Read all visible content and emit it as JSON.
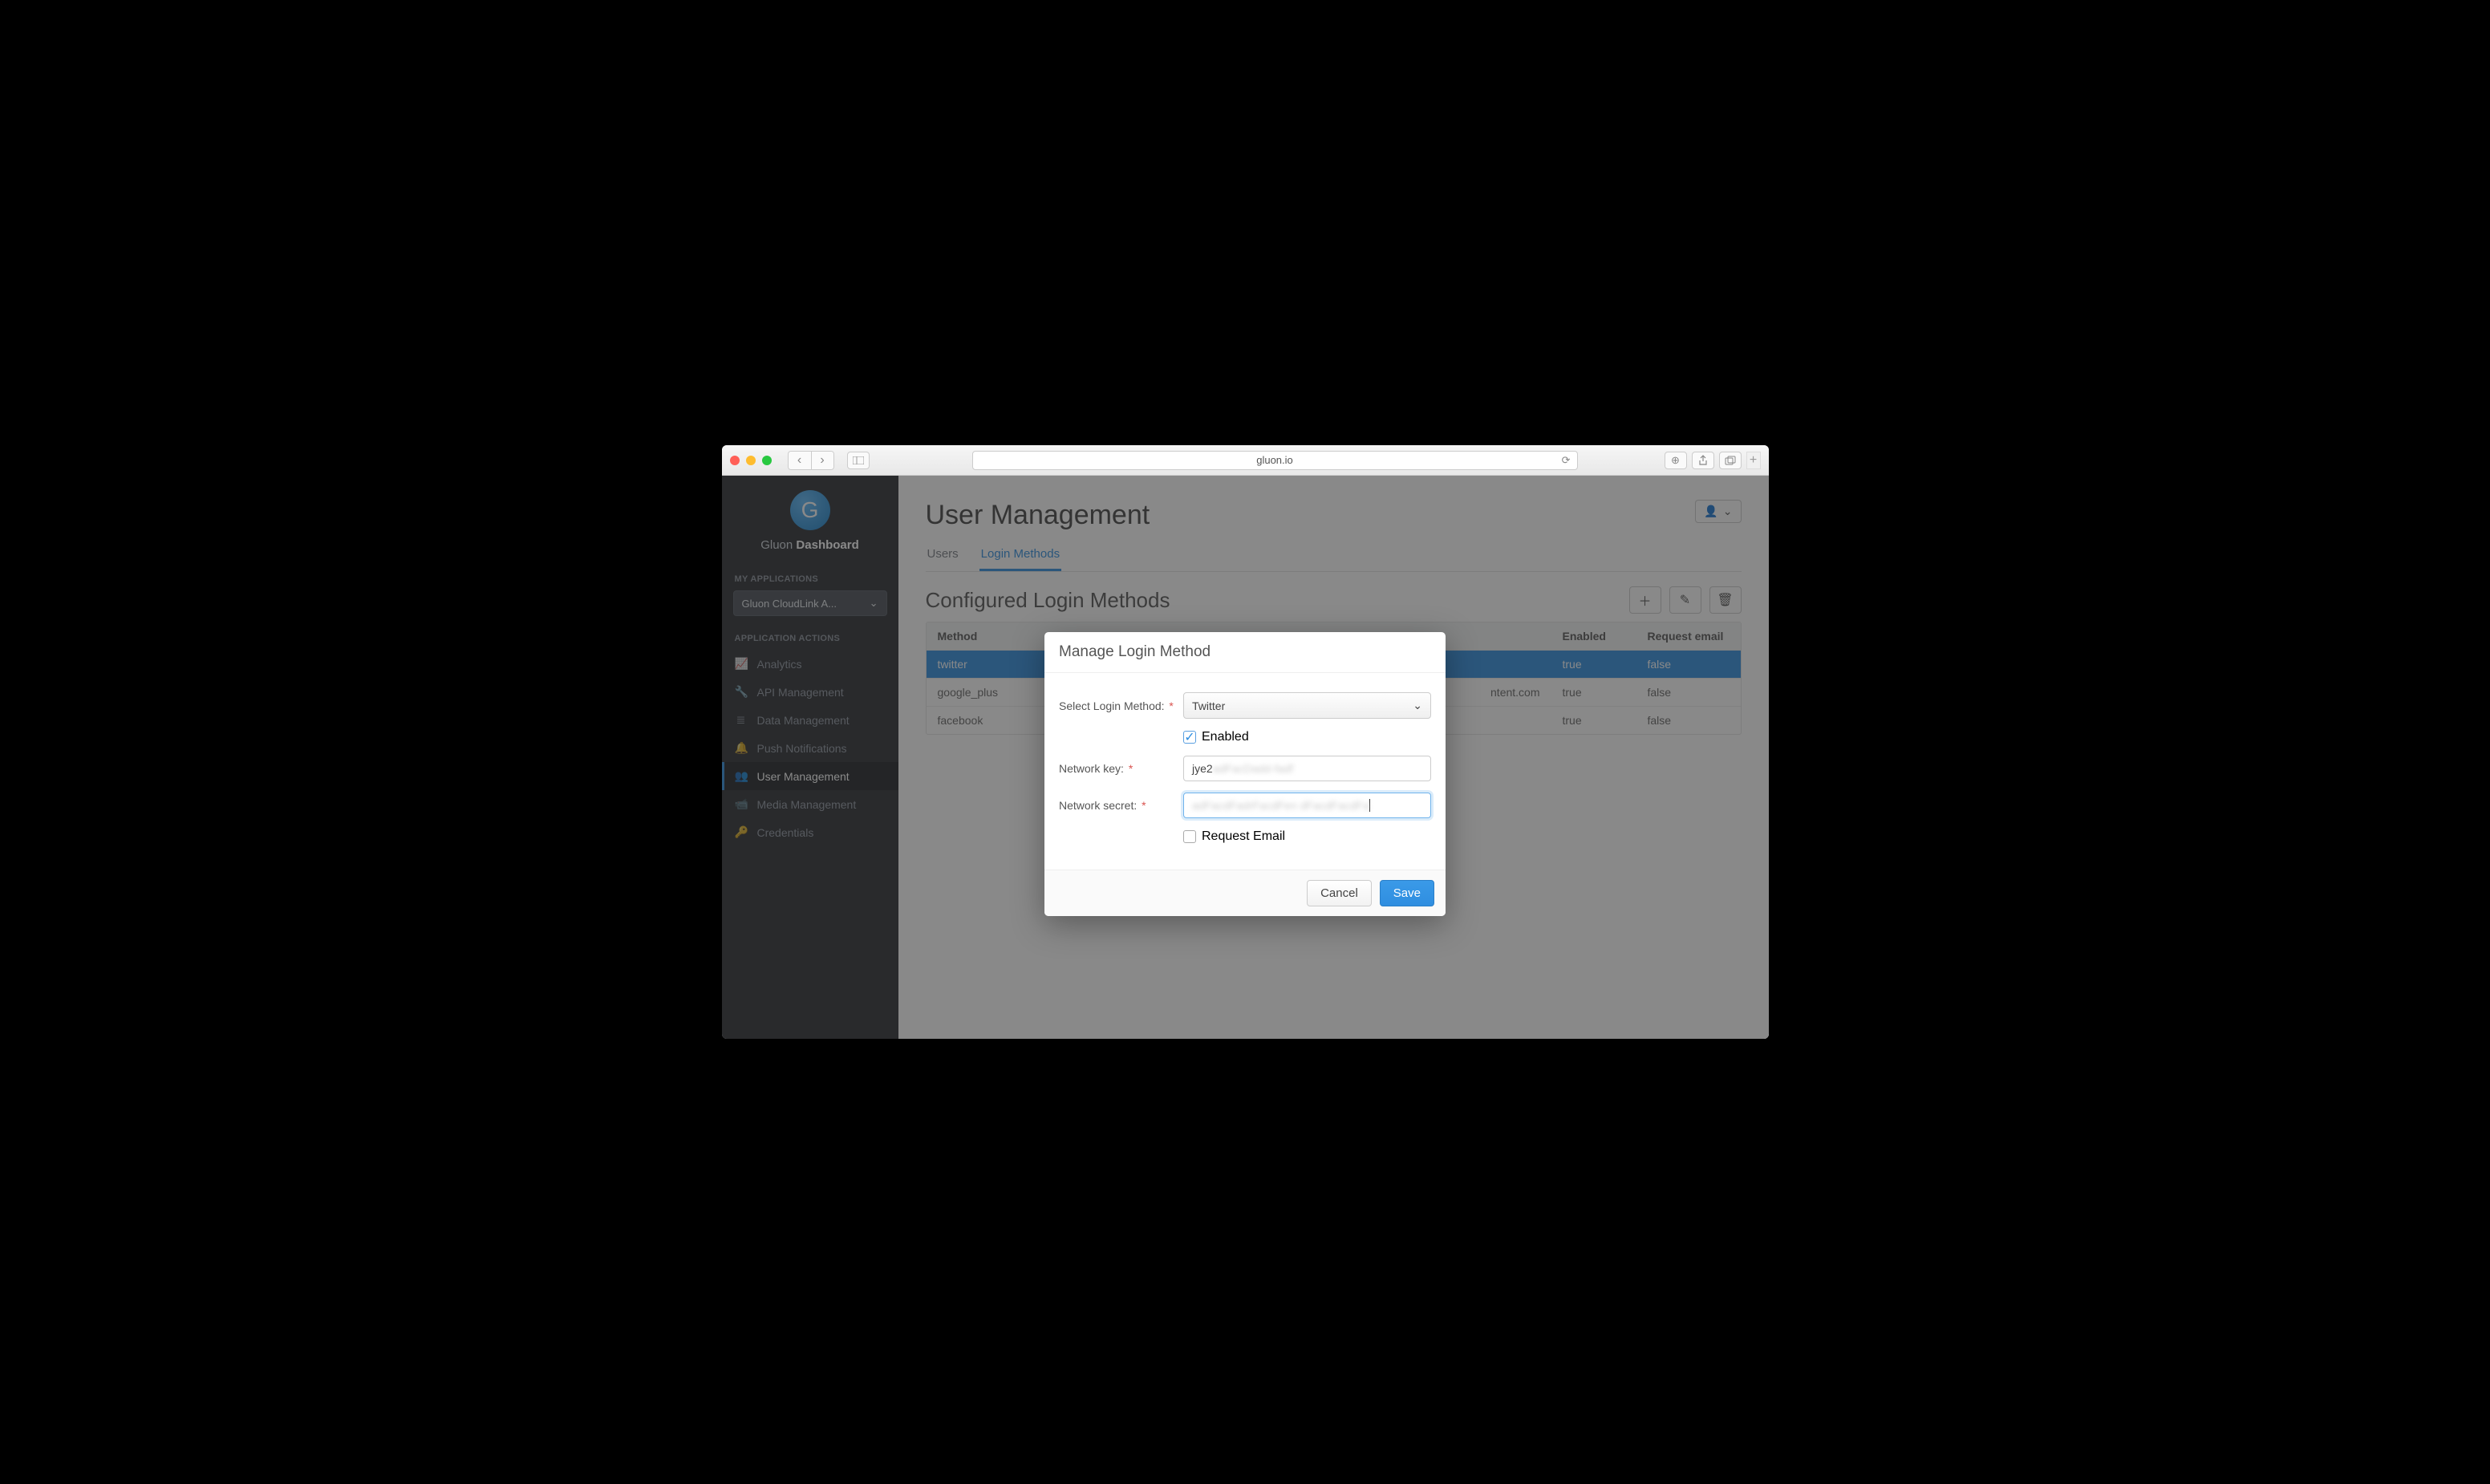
{
  "browser": {
    "url": "gluon.io"
  },
  "sidebar": {
    "brand_prefix": "Gluon ",
    "brand_bold": "Dashboard",
    "section_apps": "MY APPLICATIONS",
    "app_selector": "Gluon CloudLink A...",
    "section_actions": "APPLICATION ACTIONS",
    "items": [
      {
        "icon": "chart",
        "label": "Analytics"
      },
      {
        "icon": "wrench",
        "label": "API Management"
      },
      {
        "icon": "db",
        "label": "Data Management"
      },
      {
        "icon": "bell",
        "label": "Push Notifications"
      },
      {
        "icon": "users",
        "label": "User Management"
      },
      {
        "icon": "video",
        "label": "Media Management"
      },
      {
        "icon": "key",
        "label": "Credentials"
      }
    ]
  },
  "page": {
    "title": "User Management",
    "tabs": [
      {
        "label": "Users",
        "active": false
      },
      {
        "label": "Login Methods",
        "active": true
      }
    ],
    "section_title": "Configured Login Methods"
  },
  "table": {
    "headers": {
      "method": "Method",
      "enabled": "Enabled",
      "request_email": "Request email"
    },
    "rows": [
      {
        "method": "twitter",
        "netkey_tail": "",
        "enabled": "true",
        "request_email": "false",
        "selected": true
      },
      {
        "method": "google_plus",
        "netkey_tail": "ntent.com",
        "enabled": "true",
        "request_email": "false",
        "selected": false
      },
      {
        "method": "facebook",
        "netkey_tail": "",
        "enabled": "true",
        "request_email": "false",
        "selected": false
      }
    ]
  },
  "modal": {
    "title": "Manage Login Method",
    "labels": {
      "select": "Select Login Method:",
      "enabled": "Enabled",
      "network_key": "Network key:",
      "network_secret": "Network secret:",
      "request_email": "Request Email"
    },
    "values": {
      "method": "Twitter",
      "enabled": true,
      "network_key_prefix": "jye2",
      "request_email": false
    },
    "buttons": {
      "cancel": "Cancel",
      "save": "Save"
    }
  }
}
